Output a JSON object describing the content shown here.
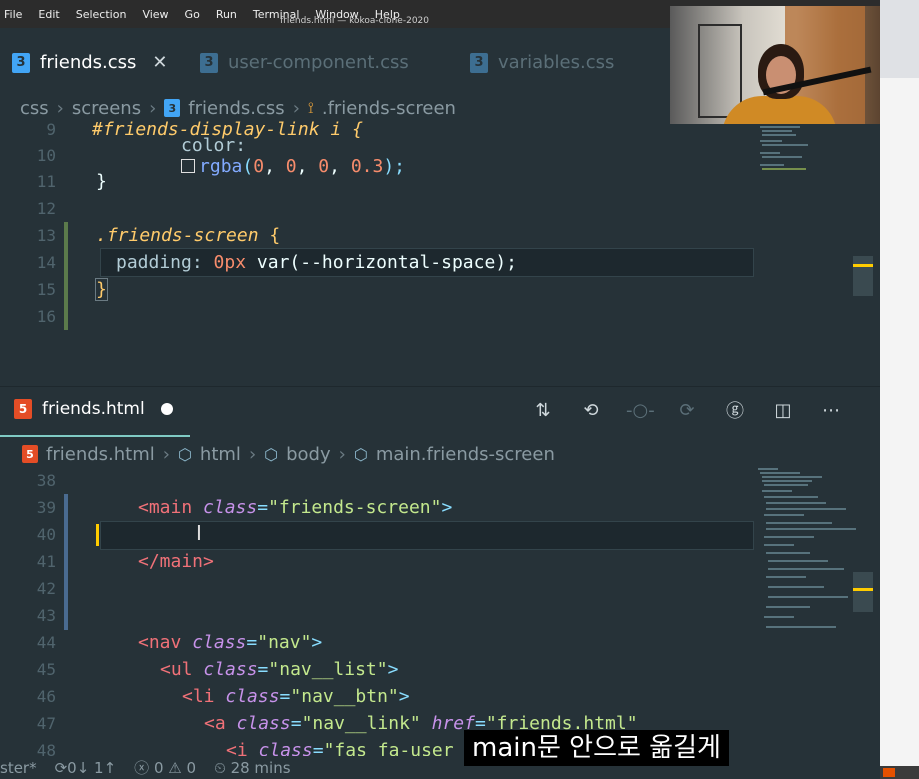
{
  "menubar": {
    "items": [
      "File",
      "Edit",
      "Selection",
      "View",
      "Go",
      "Run",
      "Terminal",
      "Window",
      "Help"
    ],
    "window_title": "friends.html — kokoa-clone-2020"
  },
  "top_tabs": [
    {
      "label": "friends.css",
      "icon": "css3-icon",
      "active": true
    },
    {
      "label": "user-component.css",
      "icon": "css3-icon",
      "active": false
    },
    {
      "label": "variables.css",
      "icon": "css3-icon",
      "active": false
    }
  ],
  "top_breadcrumb": [
    "css",
    "screens",
    "friends.css",
    ".friends-screen"
  ],
  "top_code": {
    "line_numbers": [
      "9",
      "10",
      "11",
      "12",
      "13",
      "14",
      "15",
      "16"
    ],
    "line9": "#friends-display-link i {",
    "line10_prop": "color:",
    "line10_fn": "rgba",
    "line10_open": "(",
    "line10_a": "0",
    "line10_b": "0",
    "line10_c": "0",
    "line10_d": "0.3",
    "line10_close": ");",
    "line11": "}",
    "line13_sel": ".friends-screen",
    "line13_brace": "{",
    "line14_prop": "padding:",
    "line14_num": "0px",
    "line14_rest": "var(--horizontal-space);",
    "line15": "}"
  },
  "bottom_tab": {
    "label": "friends.html",
    "icon": "html5-icon",
    "dirty": true
  },
  "bottom_breadcrumb": [
    "friends.html",
    "html",
    "body",
    "main.friends-screen"
  ],
  "bottom_code": {
    "line_numbers": [
      "38",
      "39",
      "40",
      "41",
      "42",
      "43",
      "44",
      "45",
      "46",
      "47",
      "48"
    ],
    "l39_open": "<main",
    "l39_attr": "class",
    "l39_eq": "=",
    "l39_val": "\"friends-screen\"",
    "l39_close": ">",
    "l41": "</main>",
    "l44_open": "<nav",
    "l44_attr": "class",
    "l44_val": "\"nav\"",
    "l44_close": ">",
    "l45_open": "<ul",
    "l45_attr": "class",
    "l45_val": "\"nav__list\"",
    "l45_close": ">",
    "l46_open": "<li",
    "l46_attr": "class",
    "l46_val": "\"nav__btn\"",
    "l46_close": ">",
    "l47_open": "<a",
    "l47_attr": "class",
    "l47_val": "\"nav__link\"",
    "l47_attr2": "href",
    "l47_val2": "\"friends.html\"",
    "l48_open": "<i",
    "l48_attr": "class",
    "l48_val": "\"fas fa-user"
  },
  "statusbar": {
    "branch": "ster*",
    "sync": "0↓ 1↑",
    "problems": "0",
    "warnings": "0",
    "time": "28 mins"
  },
  "subtitle": "main문 안으로 옮길게",
  "colors": {
    "editor_bg": "#263238",
    "tag": "#f07178",
    "attr": "#c792ea",
    "string": "#c3e88d",
    "selector": "#ffcb6b",
    "number": "#f78c6c",
    "function": "#82aaff"
  }
}
